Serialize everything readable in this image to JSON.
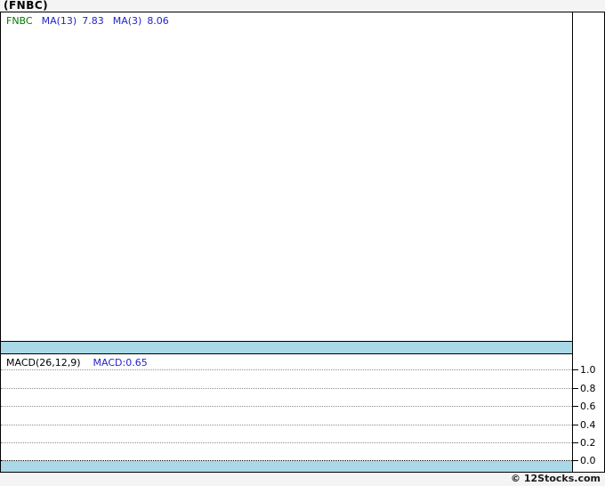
{
  "page": {
    "title": "(FNBC)",
    "footer": "© 12Stocks.com",
    "background": "#f4f4f4"
  },
  "legend": {
    "symbol": "FNBC",
    "ma1_label": "MA(13)",
    "ma1_value": "7.83",
    "ma2_label": "MA(3)",
    "ma2_value": "8.06"
  },
  "macd": {
    "label": "MACD(26,12,9)",
    "value_label": "MACD:0.65"
  },
  "colors": {
    "separator_band": "#a9d8e7",
    "symbol_green": "#007a00",
    "indicator_blue": "#2323cc",
    "grid_gray": "#8f8f8f",
    "page_background": "#f4f4f4"
  },
  "chart_data": {
    "type": "line",
    "title": "(FNBC)",
    "panels": [
      {
        "name": "price",
        "legend": [
          "FNBC",
          "MA(13) 7.83",
          "MA(3) 8.06"
        ],
        "series": [],
        "note": "plot area empty - no visible price curve"
      },
      {
        "name": "macd",
        "label": "MACD(26,12,9)",
        "macd_value": 0.65,
        "ylim": [
          0.0,
          1.0
        ],
        "ticks": [
          "1.0",
          "0.8",
          "0.6",
          "0.4",
          "0.2",
          "0.0"
        ],
        "grid": "dotted horizontal lines at each tick, zero line darker",
        "series": [],
        "note": "no visible MACD curve drawn"
      }
    ],
    "legend_position": "top-left of each panel",
    "y_axis_position": "right"
  }
}
